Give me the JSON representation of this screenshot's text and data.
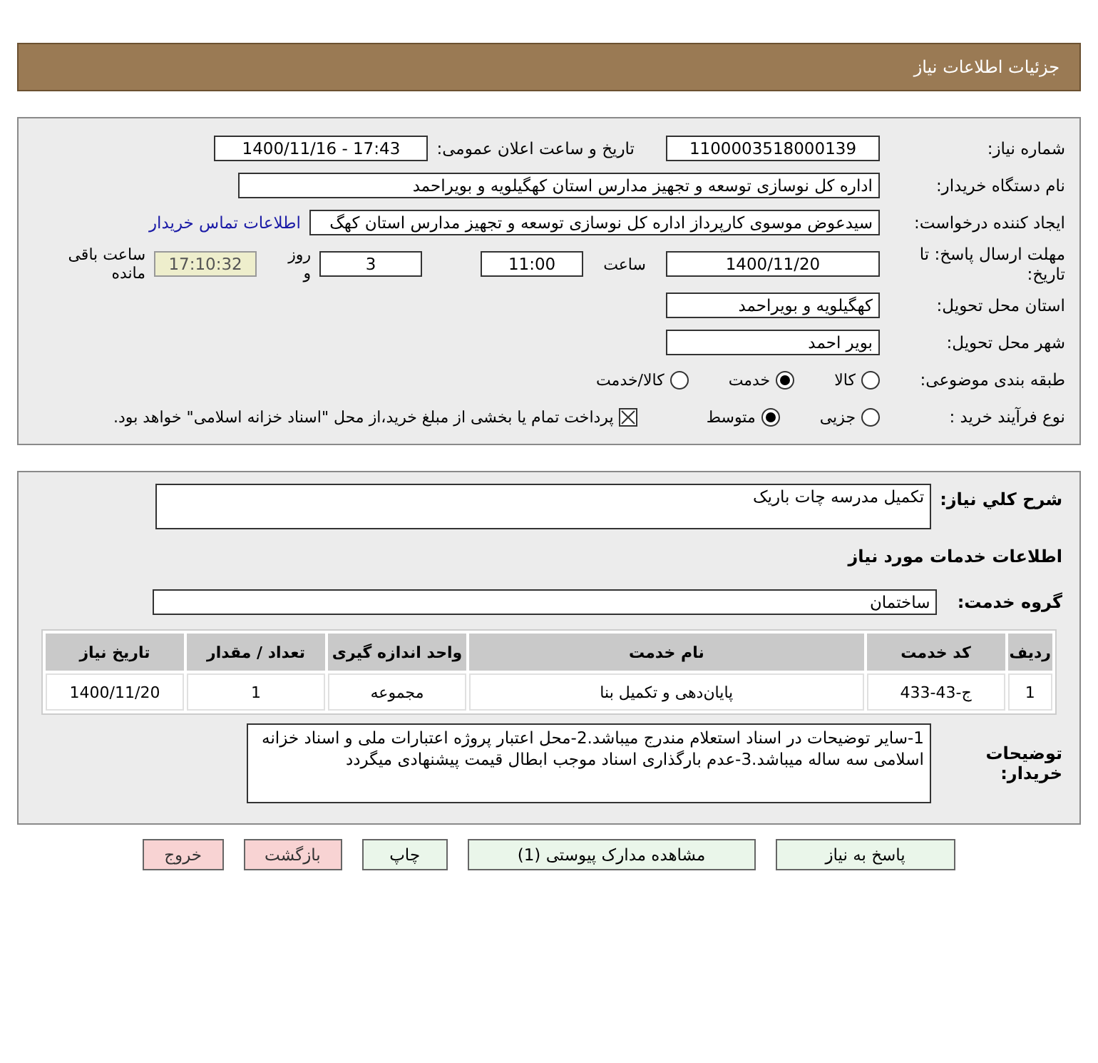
{
  "header": {
    "title": "جزئیات اطلاعات نیاز"
  },
  "info": {
    "need_number": {
      "label": "شماره نیاز:",
      "value": "1100003518000139"
    },
    "announce": {
      "label": "تاریخ و ساعت اعلان عمومی:",
      "value": "1400/11/16 - 17:43"
    },
    "buyer": {
      "label": "نام دستگاه خریدار:",
      "value": "اداره کل نوسازی  توسعه و تجهیز مدارس استان کهگیلویه و بویراحمد"
    },
    "requester": {
      "label": "ایجاد کننده درخواست:",
      "value": "سیدعوض موسوی کارپرداز اداره کل نوسازی  توسعه و تجهیز مدارس استان کهگ",
      "link": "اطلاعات تماس خریدار"
    },
    "deadline": {
      "label": "مهلت ارسال پاسخ: تا تاریخ:",
      "date": "1400/11/20",
      "time_label": "ساعت",
      "time": "11:00",
      "days": "3",
      "days_label": "روز و",
      "remaining": "17:10:32",
      "remaining_label": "ساعت باقی مانده"
    },
    "province": {
      "label": "استان محل تحویل:",
      "value": "کهگیلویه و بویراحمد"
    },
    "city": {
      "label": "شهر محل تحویل:",
      "value": "بویر احمد"
    },
    "category": {
      "label": "طبقه بندی موضوعی:",
      "options": [
        {
          "label": "کالا",
          "selected": false
        },
        {
          "label": "خدمت",
          "selected": true
        },
        {
          "label": "کالا/خدمت",
          "selected": false
        }
      ]
    },
    "process": {
      "label": "نوع فرآیند خرید :",
      "options": [
        {
          "label": "جزیی",
          "selected": false
        },
        {
          "label": "متوسط",
          "selected": true
        }
      ],
      "payment": {
        "checked": true,
        "label": "پرداخت تمام یا بخشی از مبلغ خرید،از محل \"اسناد خزانه اسلامی\" خواهد بود."
      }
    }
  },
  "details": {
    "summary": {
      "label": "شرح کلي نياز:",
      "value": "تکمیل مدرسه چات باریک"
    },
    "section_title": "اطلاعات خدمات مورد نیاز",
    "service_group": {
      "label": "گروه خدمت:",
      "value": "ساختمان"
    },
    "table": {
      "columns": [
        "ردیف",
        "کد خدمت",
        "نام خدمت",
        "واحد اندازه گیری",
        "تعداد / مقدار",
        "تاریخ نیاز"
      ],
      "rows": [
        [
          "1",
          "ج-43-433",
          "پایان‌دهی و تکمیل بنا",
          "مجموعه",
          "1",
          "1400/11/20"
        ]
      ]
    },
    "notes": {
      "label": "توضیحات خریدار:",
      "value": "1-سایر توضیحات در اسناد استعلام مندرج میباشد.2-محل اعتبار پروژه اعتبارات ملی و  اسناد خزانه اسلامی سه ساله میباشد.3-عدم بارگذاری اسناد موجب ابطال قیمت پیشنهادی میگردد"
    }
  },
  "buttons": [
    {
      "label": "پاسخ به نیاز",
      "kind": "normal"
    },
    {
      "label": "مشاهده مدارک پیوستی (1)",
      "kind": "normal"
    },
    {
      "label": "چاپ",
      "kind": "normal"
    },
    {
      "label": "بازگشت",
      "kind": "danger"
    },
    {
      "label": "خروج",
      "kind": "danger"
    }
  ]
}
